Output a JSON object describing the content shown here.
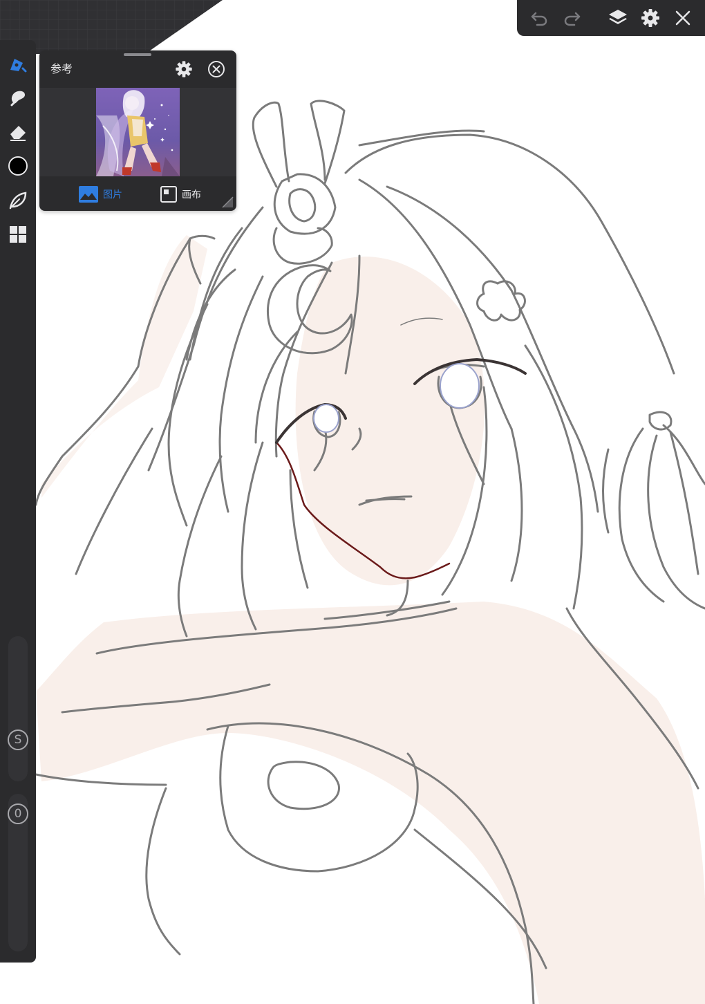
{
  "colors": {
    "toolbar_bg": "#2b2b2d",
    "accent_blue": "#2f7de0",
    "icon_light": "#e8e8ea",
    "icon_dim": "#7a7a7e",
    "current_color": "#000000",
    "skin_tone": "#f9efea",
    "line_gray": "#7b7b7b",
    "line_dark_red": "#6b1a1a"
  },
  "left_toolbar": {
    "tools": [
      {
        "name": "brush",
        "icon": "pen-icon",
        "active": true
      },
      {
        "name": "smudge",
        "icon": "smudge-icon"
      },
      {
        "name": "eraser",
        "icon": "eraser-icon"
      },
      {
        "name": "color",
        "icon": "color-swatch"
      },
      {
        "name": "lasso",
        "icon": "lasso-icon"
      },
      {
        "name": "gallery",
        "icon": "grid-icon"
      }
    ],
    "size_slider_label": "S",
    "opacity_slider_label": "0"
  },
  "top_toolbar": {
    "buttons": [
      {
        "name": "undo",
        "icon": "undo-icon",
        "enabled": false
      },
      {
        "name": "redo",
        "icon": "redo-icon",
        "enabled": false
      },
      {
        "name": "layers",
        "icon": "layers-icon"
      },
      {
        "name": "settings",
        "icon": "gear-icon"
      },
      {
        "name": "close",
        "icon": "close-icon"
      }
    ]
  },
  "reference_panel": {
    "title": "参考",
    "settings_icon": "gear-icon",
    "close_icon": "close-circle-icon",
    "modes": [
      {
        "label": "图片",
        "icon": "image-icon",
        "active": true
      },
      {
        "label": "画布",
        "icon": "canvas-icon",
        "active": false
      }
    ]
  }
}
